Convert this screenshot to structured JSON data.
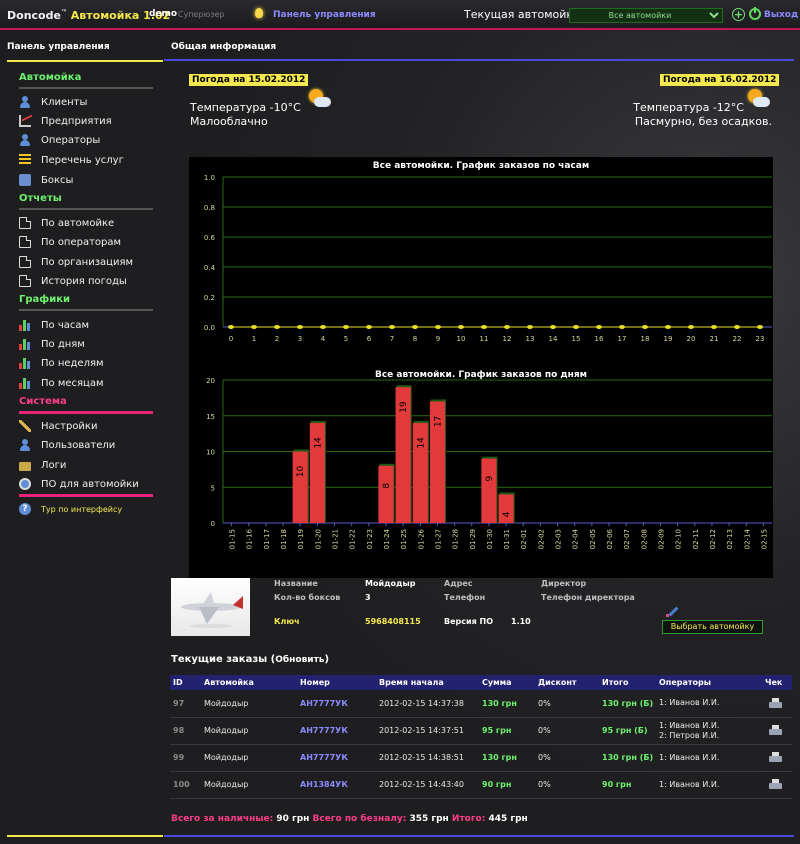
{
  "topbar": {
    "brand": "Doncode",
    "tm": "™",
    "version": "Автомойка 1.02",
    "user": "demo",
    "role": "Суперюзер",
    "panel_link": "Панель управления",
    "current_label": "Текущая автомойка",
    "current_value": "Все автомойки",
    "exit": "Выход",
    "colors": {
      "accent": "#c2185b",
      "link": "#8b8bff",
      "yellow": "#f3e84f"
    }
  },
  "sidebar": {
    "title": "Панель управления",
    "sections": [
      {
        "title": "Автомойка",
        "items": [
          {
            "label": "Клиенты",
            "icon": "user-icon"
          },
          {
            "label": "Предприятия",
            "icon": "chart-icon"
          },
          {
            "label": "Операторы",
            "icon": "user-icon"
          },
          {
            "label": "Перечень услуг",
            "icon": "list-icon"
          },
          {
            "label": "Боксы",
            "icon": "box-icon"
          }
        ]
      },
      {
        "title": "Отчеты",
        "items": [
          {
            "label": "По автомойке",
            "icon": "document-icon"
          },
          {
            "label": "По операторам",
            "icon": "document-icon"
          },
          {
            "label": "По организациям",
            "icon": "document-icon"
          },
          {
            "label": "История погоды",
            "icon": "document-icon"
          }
        ]
      },
      {
        "title": "Графики",
        "items": [
          {
            "label": "По часам",
            "icon": "bar-chart-icon"
          },
          {
            "label": "По дням",
            "icon": "bar-chart-icon"
          },
          {
            "label": "По неделям",
            "icon": "bar-chart-icon"
          },
          {
            "label": "По месяцам",
            "icon": "bar-chart-icon"
          }
        ]
      },
      {
        "title": "Система",
        "items": [
          {
            "label": "Настройки",
            "icon": "wrench-icon"
          },
          {
            "label": "Пользователи",
            "icon": "user-icon"
          },
          {
            "label": "Логи",
            "icon": "folder-icon"
          },
          {
            "label": "ПО для автомойки",
            "icon": "disk-icon"
          }
        ]
      }
    ],
    "tour": "Тур по интерфейсу"
  },
  "main": {
    "title": "Общая информация",
    "weather": [
      {
        "date": "Погода на 15.02.2012",
        "temp": "Температура -10°C",
        "desc": "Малооблачно"
      },
      {
        "date": "Погода на 16.02.2012",
        "temp": "Температура -12°C",
        "desc": "Пасмурно, без осадков."
      }
    ],
    "carwash": {
      "name_label": "Название",
      "name": "Мойдодыр",
      "boxes_label": "Кол-во боксов",
      "boxes": "3",
      "key_label": "Ключ",
      "key": "5968408115",
      "sw_label": "Версия ПО",
      "sw": "1.10",
      "address_label": "Адрес",
      "phone_label": "Телефон",
      "director_label": "Директор",
      "director_phone_label": "Телефон директора",
      "choose_button": "Выбрать автомойку"
    },
    "orders": {
      "title": "Текущие заказы",
      "refresh": "Обновить",
      "columns": [
        "ID",
        "Автомойка",
        "Номер",
        "Время начала",
        "Сумма",
        "Дисконт",
        "Итого",
        "Операторы",
        "Чек"
      ],
      "rows": [
        {
          "id": "97",
          "wash": "Мойдодыр",
          "plate": "АН7777УК",
          "time": "2012-02-15 14:37:38",
          "sum": "130 грн",
          "discount": "0%",
          "total": "130 грн (Б)",
          "operators": [
            "1: Иванов И.И."
          ]
        },
        {
          "id": "98",
          "wash": "Мойдодыр",
          "plate": "АН7777УК",
          "time": "2012-02-15 14:37:51",
          "sum": "95 грн",
          "discount": "0%",
          "total": "95 грн (Б)",
          "operators": [
            "1: Иванов И.И.",
            "2: Петров И.И."
          ]
        },
        {
          "id": "99",
          "wash": "Мойдодыр",
          "plate": "АН7777УК",
          "time": "2012-02-15 14:38:51",
          "sum": "130 грн",
          "discount": "0%",
          "total": "130 грн (Б)",
          "operators": [
            "1: Иванов И.И."
          ]
        },
        {
          "id": "100",
          "wash": "Мойдодыр",
          "plate": "АН1384УК",
          "time": "2012-02-15 14:43:40",
          "sum": "90 грн",
          "discount": "0%",
          "total": "90 грн",
          "operators": [
            "1: Иванов И.И."
          ]
        }
      ],
      "totals": {
        "cash_label": "Всего за наличные:",
        "cash": "90 грн",
        "card_label": "Всего по безналу:",
        "card": "355 грн",
        "total_label": "Итого:",
        "total": "445 грн"
      }
    }
  },
  "chart_data": [
    {
      "type": "line",
      "title": "Все автомойки. График заказов по часам",
      "x": [
        0,
        1,
        2,
        3,
        4,
        5,
        6,
        7,
        8,
        9,
        10,
        11,
        12,
        13,
        14,
        15,
        16,
        17,
        18,
        19,
        20,
        21,
        22,
        23
      ],
      "values": [
        0,
        0,
        0,
        0,
        0,
        0,
        0,
        0,
        0,
        0,
        0,
        0,
        0,
        0,
        0,
        0,
        0,
        0,
        0,
        0,
        0,
        0,
        0,
        0
      ],
      "ylim": [
        0,
        1.0
      ],
      "yticks": [
        "0.0",
        "0.2",
        "0.4",
        "0.6",
        "0.8",
        "1.0"
      ],
      "grid": true,
      "colors": {
        "line": "#e8e020",
        "grid": "#2a6a12"
      }
    },
    {
      "type": "bar",
      "title": "Все автомойки. График заказов по дням",
      "categories": [
        "01-15",
        "01-16",
        "01-17",
        "01-18",
        "01-19",
        "01-20",
        "01-21",
        "01-22",
        "01-23",
        "01-24",
        "01-25",
        "01-26",
        "01-27",
        "01-28",
        "01-29",
        "01-30",
        "01-31",
        "02-01",
        "02-02",
        "02-03",
        "02-04",
        "02-05",
        "02-06",
        "02-07",
        "02-08",
        "02-09",
        "02-10",
        "02-11",
        "02-12",
        "02-13",
        "02-14",
        "02-15"
      ],
      "values": [
        0,
        0,
        0,
        0,
        10,
        14,
        0,
        0,
        0,
        8,
        19,
        14,
        17,
        0,
        0,
        9,
        4,
        0,
        0,
        0,
        0,
        0,
        0,
        0,
        0,
        0,
        0,
        0,
        0,
        0,
        0,
        0
      ],
      "ylim": [
        0,
        20
      ],
      "yticks": [
        "0",
        "5",
        "10",
        "15",
        "20"
      ],
      "grid": true,
      "colors": {
        "bar": "#e23a3a",
        "grid": "#2a6a12"
      }
    }
  ]
}
